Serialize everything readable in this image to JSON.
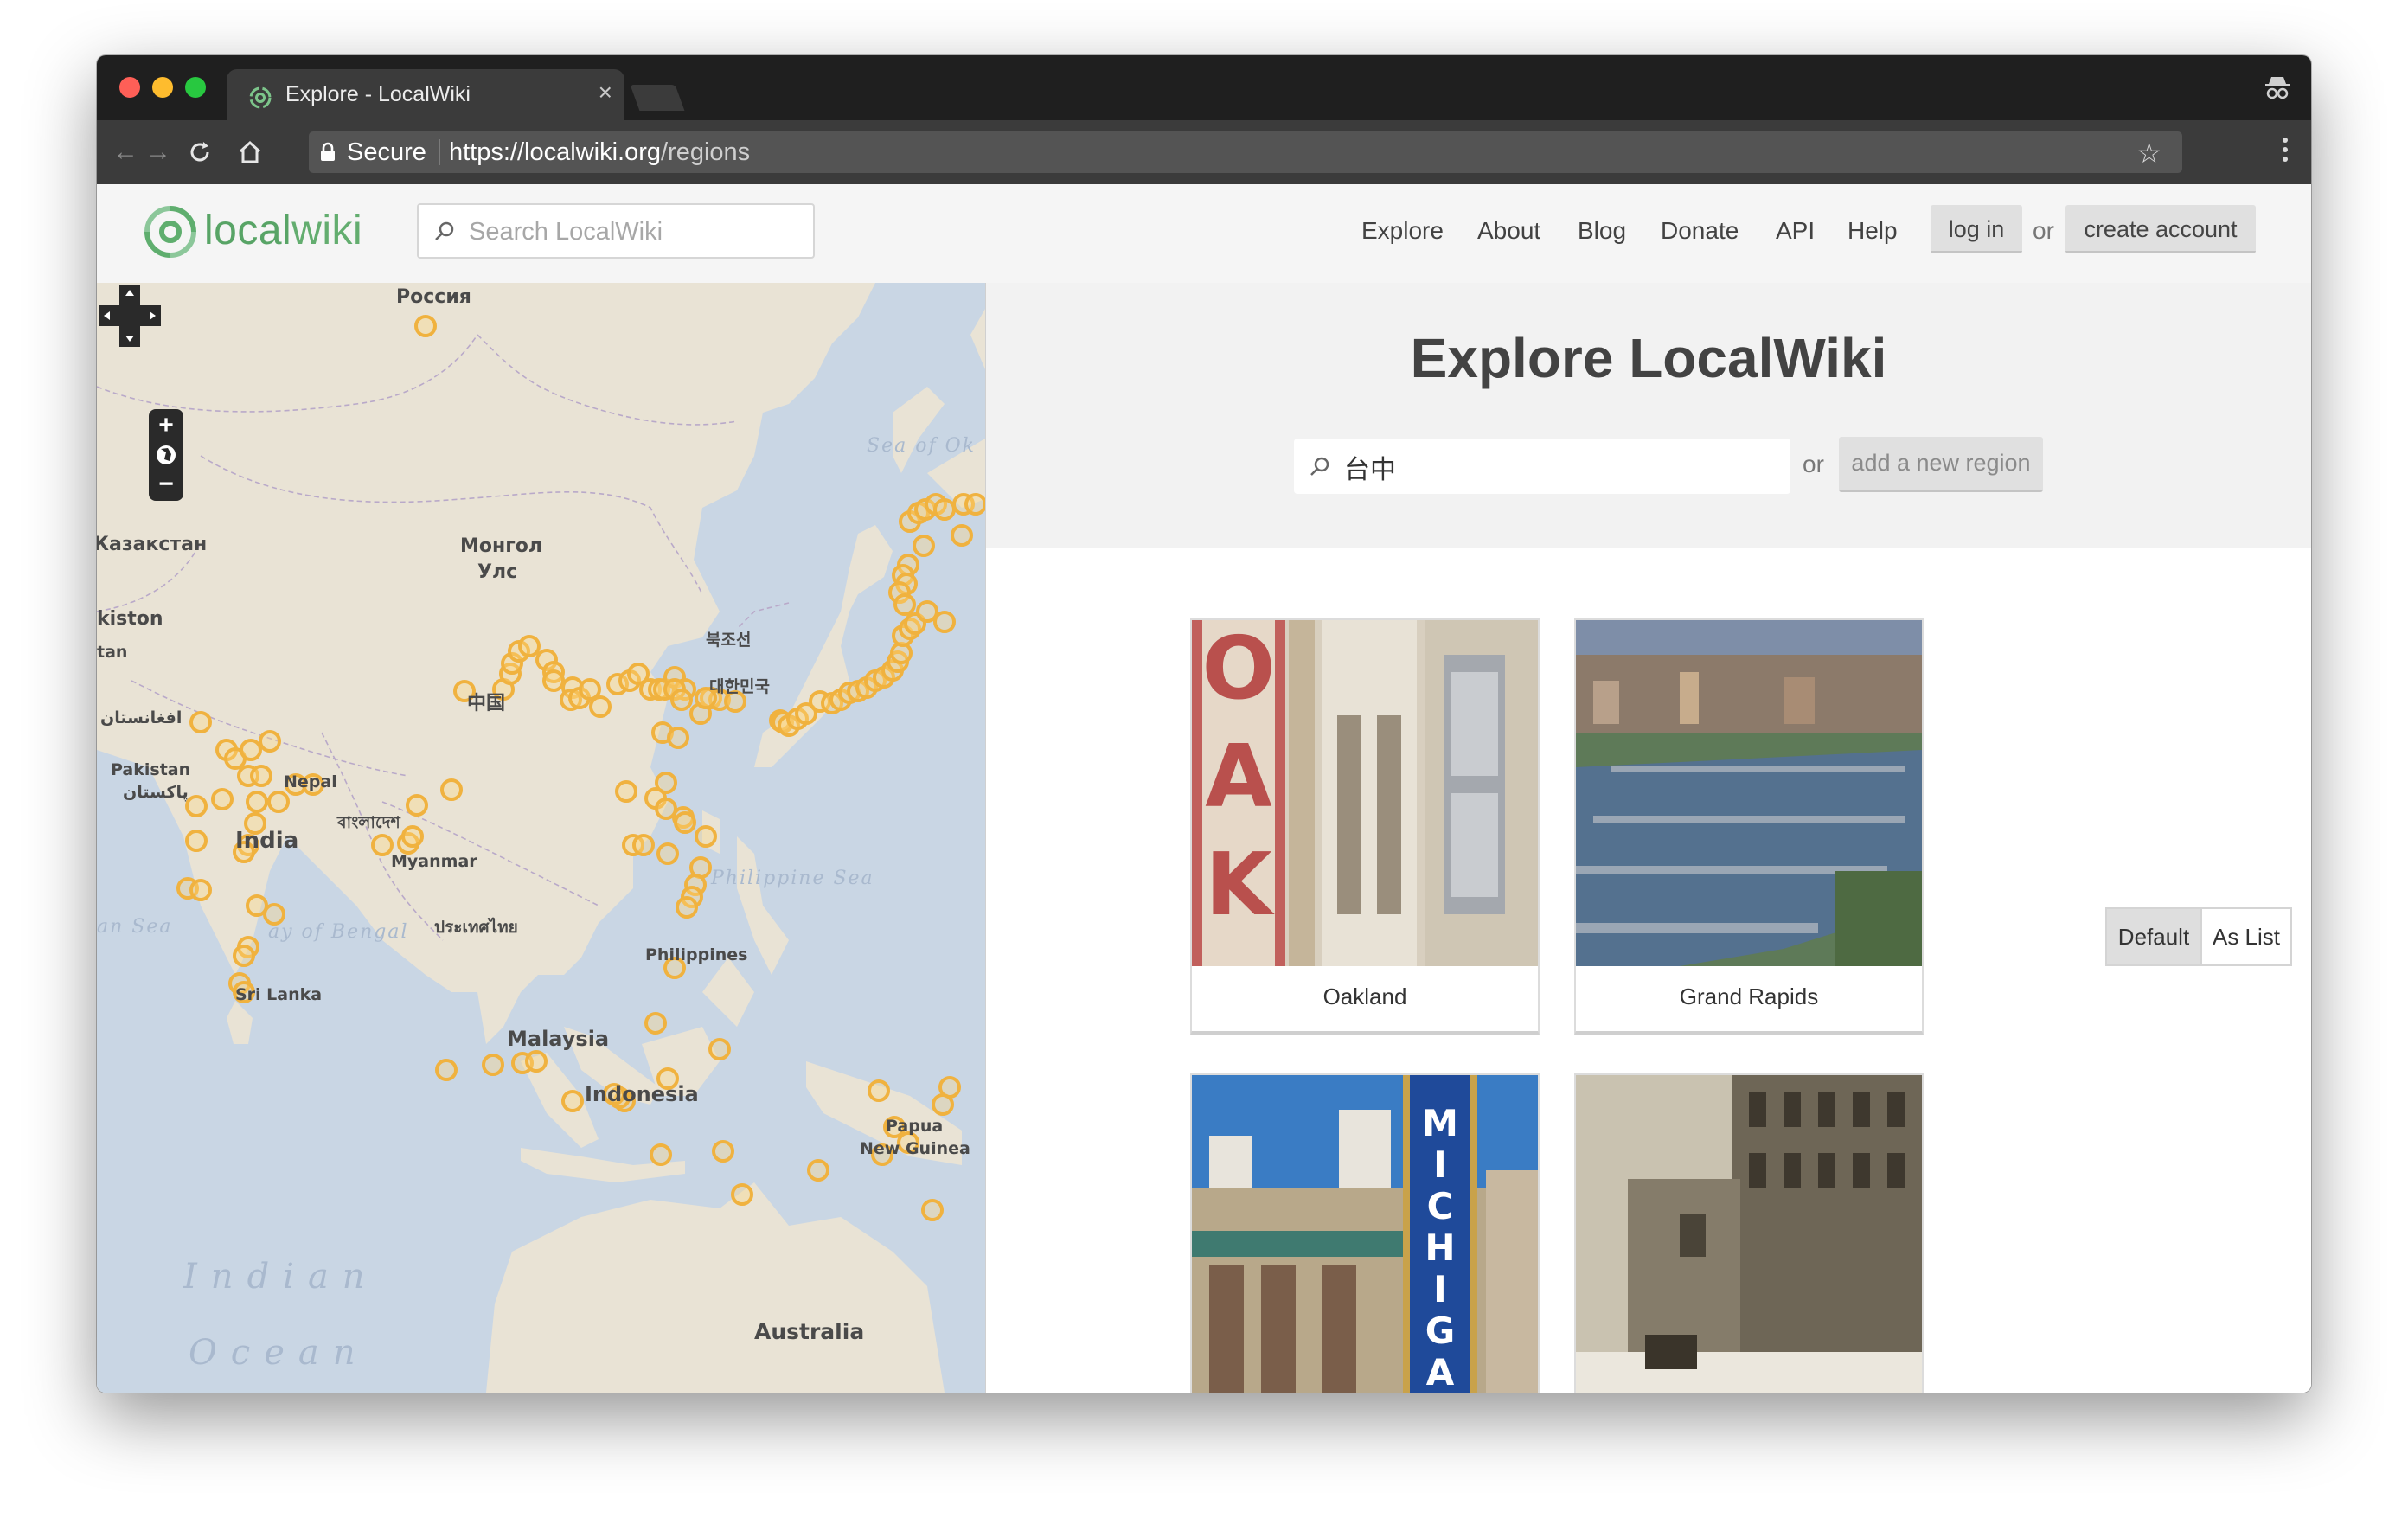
{
  "browser": {
    "tab_title": "Explore - LocalWiki",
    "tab_close": "×",
    "secure_label": "Secure",
    "url_scheme": "https://",
    "url_host": "localwiki.org",
    "url_path": "/regions"
  },
  "site": {
    "logo_text_local": "local",
    "logo_text_wiki": "wiki",
    "search_placeholder": "Search LocalWiki",
    "nav": [
      "Explore",
      "About",
      "Blog",
      "Donate",
      "API",
      "Help"
    ],
    "login_label": "log in",
    "or_label": "or",
    "create_account_label": "create account"
  },
  "map": {
    "labels": {
      "russia": "Россия",
      "kazakhstan": "Казакстан",
      "mongolia_1": "Монгол",
      "mongolia_2": "Улс",
      "china": "中国",
      "north_korea": "북조선",
      "south_korea": "대한민국",
      "pakistan": "Pakistan",
      "pakistan_local": "پاکستان",
      "afghanistan": "افغانستان",
      "kistan": "kiston",
      "tan": "tan",
      "nepal": "Nepal",
      "india": "India",
      "bangladesh": "বাংলাদেশ",
      "myanmar": "Myanmar",
      "thailand": "ประเทศไทย",
      "sri_lanka": "Sri Lanka",
      "philippines": "Philippines",
      "malaysia": "Malaysia",
      "indonesia": "Indonesia",
      "papua_1": "Papua",
      "papua_2": "New Guinea",
      "australia": "Australia",
      "indian_ocean_1": "Indian",
      "indian_ocean_2": "Ocean",
      "philippine_sea": "Philippine Sea",
      "bay_of_bengal": "ay of Bengal",
      "arabian_sea": "an Sea",
      "sea_of_okhotsk": "Sea of Ok"
    },
    "marker_color": "#f0b23f"
  },
  "explore": {
    "title": "Explore LocalWiki",
    "search_value": "台中",
    "or_label": "or",
    "add_region_label": "add a new region",
    "view_default": "Default",
    "view_list": "As List",
    "regions": [
      "Oakland",
      "Grand Rapids",
      "",
      ""
    ]
  }
}
